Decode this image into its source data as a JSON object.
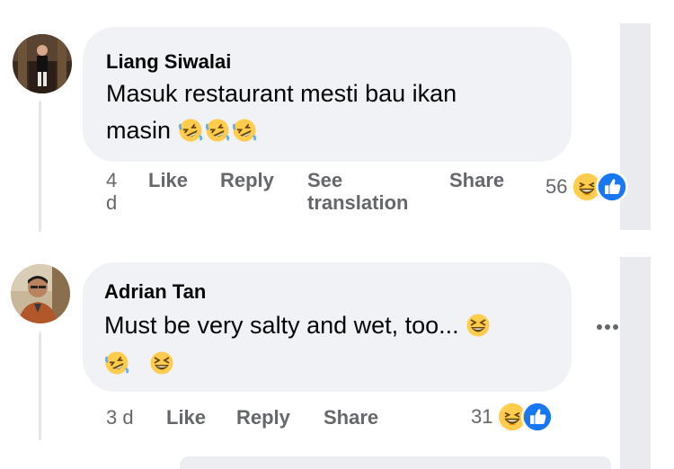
{
  "comments": [
    {
      "author": "Liang Siwalai",
      "text_line1": "Masuk restaurant mesti bau ikan",
      "text_line2": "masin",
      "inline_emojis": [
        "rolling-on-floor-laughing",
        "rolling-on-floor-laughing",
        "rolling-on-floor-laughing"
      ],
      "time_line1": "4",
      "time_line2": "d",
      "like_label": "Like",
      "reply_label": "Reply",
      "see_translation_line1": "See",
      "see_translation_line2": "translation",
      "share_label": "Share",
      "reaction_count": "56",
      "reaction_icons": [
        "haha",
        "like"
      ]
    },
    {
      "author": "Adrian Tan",
      "text_line1": "Must be very salty and wet, too...",
      "inline_emojis_line1": [
        "grinning-squinting-face"
      ],
      "inline_emojis_line2": [
        "rolling-on-floor-laughing",
        "grinning-squinting-face"
      ],
      "time": "3 d",
      "like_label": "Like",
      "reply_label": "Reply",
      "share_label": "Share",
      "reaction_count": "31",
      "reaction_icons": [
        "haha",
        "like"
      ],
      "more_icon": "more-horizontal-icon"
    }
  ],
  "colors": {
    "bubble": "#f0f2f5",
    "meta_text": "#65676b",
    "like_blue": "#1877f2",
    "emoji_yellow": "#ffcc4d"
  }
}
